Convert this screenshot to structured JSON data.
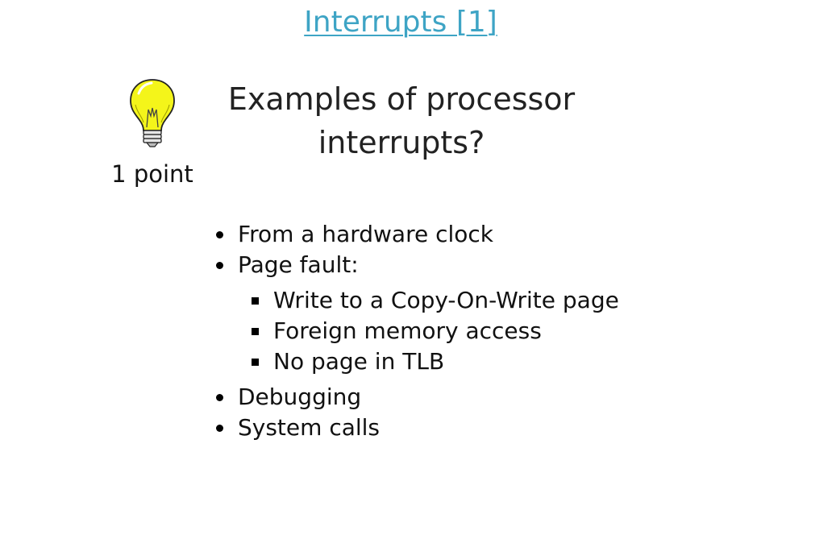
{
  "header": {
    "title": "Interrupts [1]"
  },
  "question": {
    "text": "Examples of processor interrupts?",
    "points": "1 point",
    "icon": "lightbulb-icon"
  },
  "answers": {
    "items": [
      {
        "label": "From a hardware clock"
      },
      {
        "label": "Page fault:"
      }
    ],
    "page_fault_subitems": [
      {
        "label": "Write to a Copy-On-Write page"
      },
      {
        "label": "Foreign memory access"
      },
      {
        "label": "No page in TLB"
      }
    ],
    "more_items": [
      {
        "label": "Debugging"
      },
      {
        "label": "System calls"
      }
    ]
  },
  "colors": {
    "title_link": "#3ea4c5",
    "bulb_glass": "#f4f51a",
    "text": "#111111"
  }
}
